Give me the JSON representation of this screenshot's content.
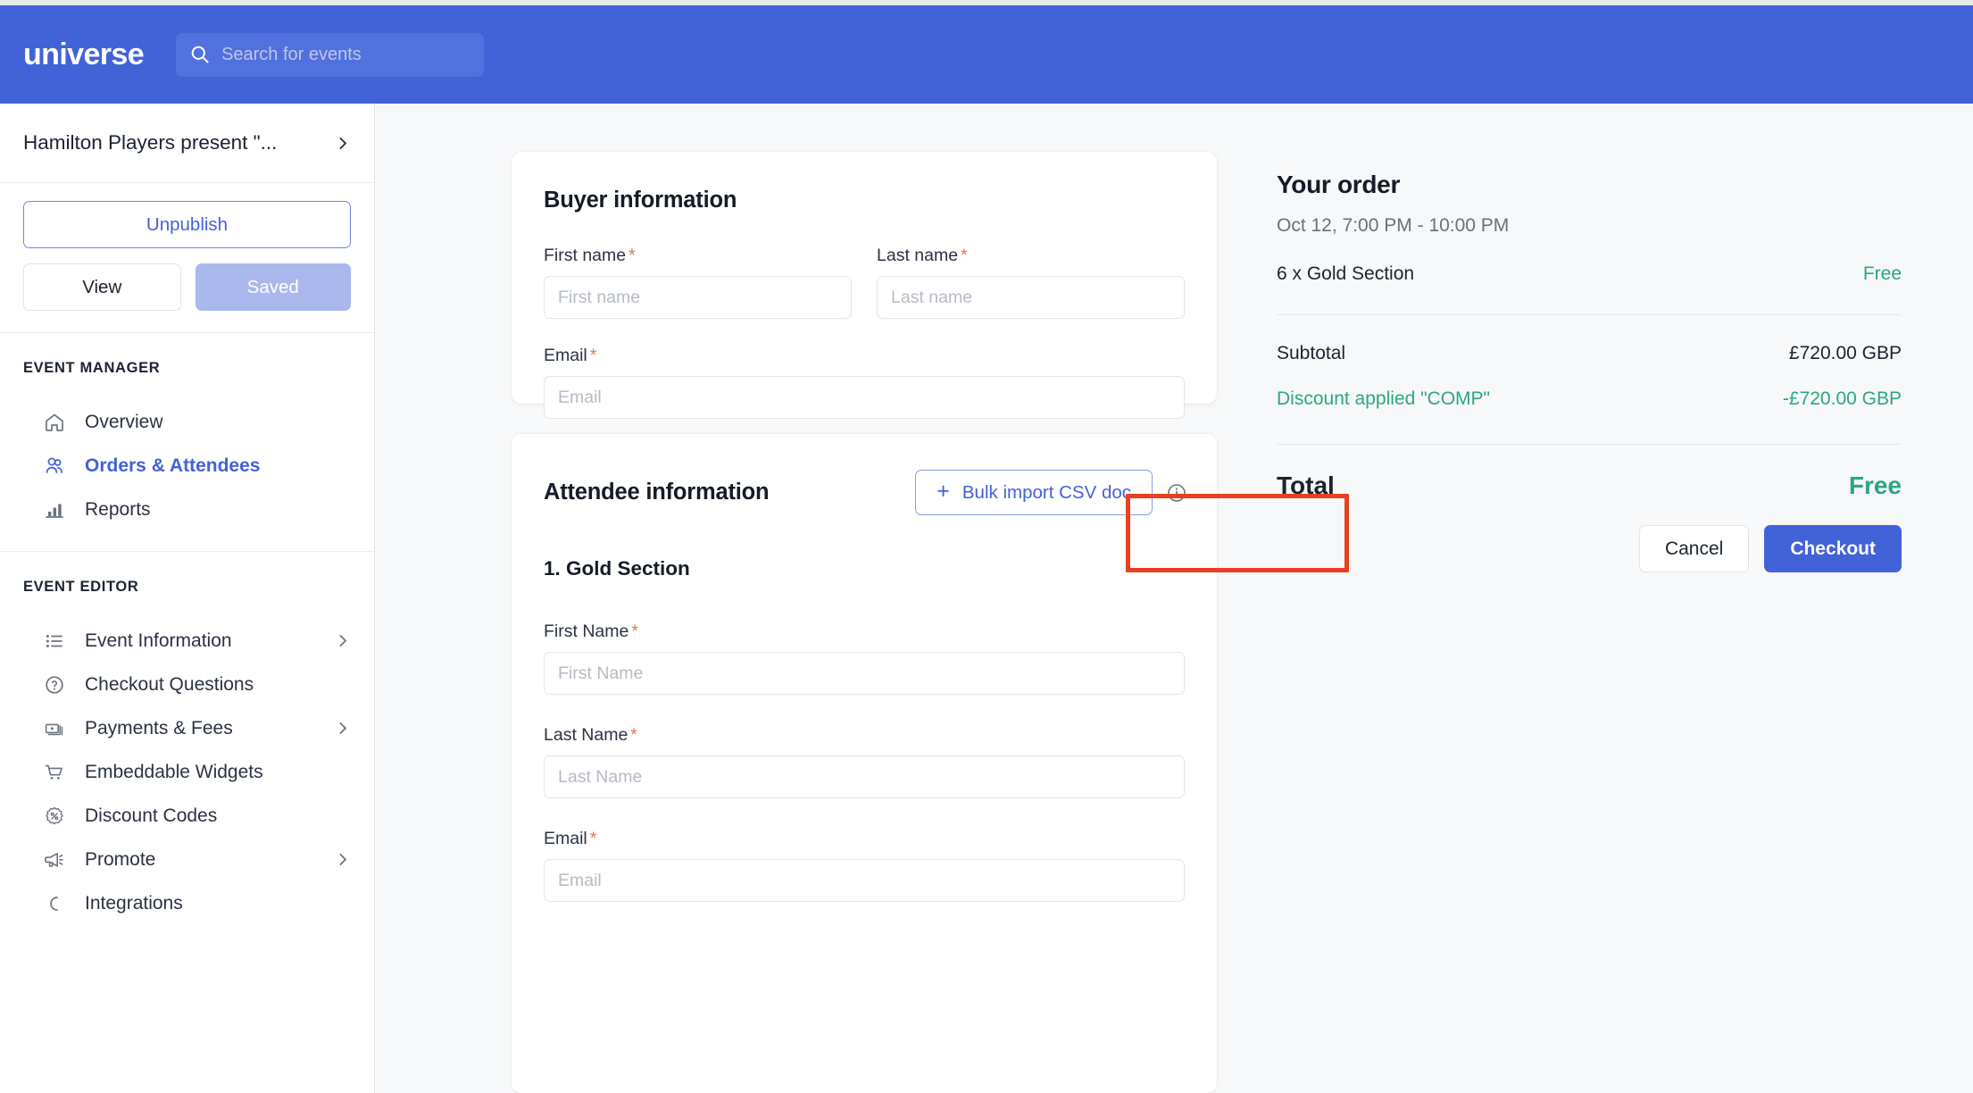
{
  "header": {
    "logo": "universe",
    "search_placeholder": "Search for events",
    "search_value": "",
    "search_icon": "search-icon",
    "background_color": "#4262D8"
  },
  "sidebar": {
    "event_title": "Hamilton Players present \"...",
    "event_chevron_icon": "chevron-right-icon",
    "unpublish_label": "Unpublish",
    "view_label": "View",
    "saved_label": "Saved",
    "groups": [
      {
        "title": "EVENT MANAGER",
        "items": [
          {
            "label": "Overview",
            "icon": "home-icon",
            "active": false,
            "chevron": false
          },
          {
            "label": "Orders & Attendees",
            "icon": "people-icon",
            "active": true,
            "chevron": false
          },
          {
            "label": "Reports",
            "icon": "bar-chart-icon",
            "active": false,
            "chevron": false
          }
        ]
      },
      {
        "title": "EVENT EDITOR",
        "items": [
          {
            "label": "Event Information",
            "icon": "list-icon",
            "active": false,
            "chevron": true
          },
          {
            "label": "Checkout Questions",
            "icon": "question-circle-icon",
            "active": false,
            "chevron": false
          },
          {
            "label": "Payments & Fees",
            "icon": "money-icon",
            "active": false,
            "chevron": true
          },
          {
            "label": "Embeddable Widgets",
            "icon": "cart-icon",
            "active": false,
            "chevron": false
          },
          {
            "label": "Discount Codes",
            "icon": "discount-badge-icon",
            "active": false,
            "chevron": false
          },
          {
            "label": "Promote",
            "icon": "megaphone-icon",
            "active": false,
            "chevron": true
          },
          {
            "label": "Integrations",
            "icon": "integrations-icon",
            "active": false,
            "chevron": false
          }
        ]
      }
    ]
  },
  "buyer_card": {
    "title": "Buyer information",
    "first_name_label": "First name",
    "first_name_placeholder": "First name",
    "first_name_value": "",
    "last_name_label": "Last name",
    "last_name_placeholder": "Last name",
    "last_name_value": "",
    "email_label": "Email",
    "email_placeholder": "Email",
    "email_value": "",
    "required_marker": "*"
  },
  "attendee_card": {
    "title": "Attendee information",
    "bulk_import_label": "Bulk import CSV doc",
    "bulk_import_plus": "+",
    "info_icon": "info-circle-icon",
    "section_label": "1. Gold Section",
    "first_name_label": "First Name",
    "first_name_placeholder": "First Name",
    "first_name_value": "",
    "last_name_label": "Last Name",
    "last_name_placeholder": "Last Name",
    "last_name_value": "",
    "email_label": "Email",
    "email_placeholder": "Email",
    "email_value": "",
    "required_marker": "*"
  },
  "order": {
    "title": "Your order",
    "date": "Oct 12, 7:00 PM - 10:00 PM",
    "item_label": "6 x Gold Section",
    "item_price": "Free",
    "subtotal_label": "Subtotal",
    "subtotal_value": "£720.00 GBP",
    "discount_label": "Discount applied \"COMP\"",
    "discount_value": "-£720.00 GBP",
    "total_label": "Total",
    "total_value": "Free",
    "cancel_label": "Cancel",
    "checkout_label": "Checkout",
    "accent_green": "#2CA680",
    "accent_blue": "#4262D8"
  },
  "annotation": {
    "color": "#E8401F",
    "target": "bulk-import-csv-doc-button"
  }
}
